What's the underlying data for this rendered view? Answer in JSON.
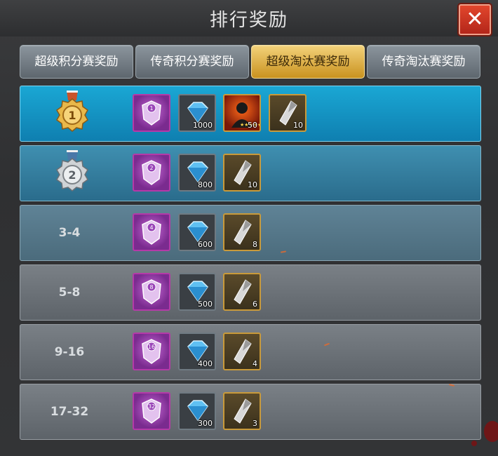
{
  "window": {
    "title": "排行奖励",
    "close_icon": "close-icon"
  },
  "tabs": [
    {
      "label": "超级积分赛奖励",
      "active": false
    },
    {
      "label": "传奇积分赛奖励",
      "active": false
    },
    {
      "label": "超级淘汰赛奖励",
      "active": true
    },
    {
      "label": "传奇淘汰赛奖励",
      "active": false
    }
  ],
  "rows": [
    {
      "rank": "1",
      "rank_icon": "gold-medal-icon",
      "badge_number": "1",
      "gems": "1000",
      "hero_count": "50",
      "hero_stars": 5,
      "stones": "10"
    },
    {
      "rank": "2",
      "rank_icon": "silver-medal-icon",
      "badge_number": "2",
      "gems": "800",
      "stones": "10"
    },
    {
      "rank": "3-4",
      "badge_number": "4",
      "gems": "600",
      "stones": "8"
    },
    {
      "rank": "5-8",
      "badge_number": "8",
      "gems": "500",
      "stones": "6"
    },
    {
      "rank": "9-16",
      "badge_number": "16",
      "gems": "400",
      "stones": "4"
    },
    {
      "rank": "17-32",
      "badge_number": "32",
      "gems": "300",
      "stones": "3"
    }
  ],
  "colors": {
    "accent_tab": "#e0b448",
    "row_top": "#1aa7d4",
    "close_bg": "#d23a24"
  }
}
